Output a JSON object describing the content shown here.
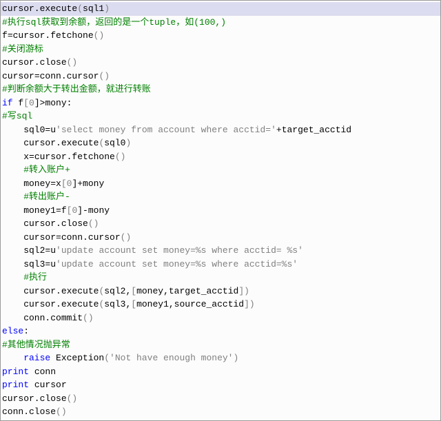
{
  "code": {
    "line01": {
      "t1": "cursor.execute",
      "t2": "(",
      "t3": "sql1",
      "t4": ")"
    },
    "line02": {
      "t1": "#执行sql获取到余额，返回的是一个tuple，如(100,)"
    },
    "line03": {
      "t1": "f",
      "t2": "=cursor.fetchone",
      "t3": "()"
    },
    "line04": {
      "t1": "#关闭游标"
    },
    "line05": {
      "t1": "cursor.close",
      "t2": "()"
    },
    "line06": {
      "t1": "cursor",
      "t2": "=conn.cursor",
      "t3": "()"
    },
    "line07": {
      "t1": "#判断余额大于转出金额，就进行转账"
    },
    "line08": {
      "t1": "if ",
      "t2": "f",
      "t3": "[",
      "t4": "0",
      "t5": "]>mony:"
    },
    "line09": {
      "t1": "#写sql"
    },
    "line10": {
      "t1": "    sql0",
      "t2": "=u",
      "t3": "'select money from account where acctid='",
      "t4": "+target_acctid"
    },
    "line11": {
      "t1": "    cursor.execute",
      "t2": "(",
      "t3": "sql0",
      "t4": ")"
    },
    "line12": {
      "t1": "    x",
      "t2": "=cursor.fetchone",
      "t3": "()"
    },
    "line13": {
      "t1": "    #转入账户+"
    },
    "line14": {
      "t1": "    money",
      "t2": "=x",
      "t3": "[",
      "t4": "0",
      "t5": "]+mony"
    },
    "line15": {
      "t1": "    #转出账户-"
    },
    "line16": {
      "t1": "    money1",
      "t2": "=f",
      "t3": "[",
      "t4": "0",
      "t5": "]-mony"
    },
    "line17": {
      "t1": "    cursor.close",
      "t2": "()"
    },
    "line18": {
      "t1": "    cursor",
      "t2": "=conn.cursor",
      "t3": "()"
    },
    "line19": {
      "t1": "    sql2",
      "t2": "=u",
      "t3": "'update account set money=%s where acctid= %s'"
    },
    "line20": {
      "t1": "    sql3",
      "t2": "=u",
      "t3": "'update account set money=%s where acctid=%s'"
    },
    "line21": {
      "t1": "    #执行"
    },
    "line22": {
      "t1": "    cursor.execute",
      "t2": "(",
      "t3": "sql2,",
      "t4": "[",
      "t5": "money,target_acctid",
      "t6": "])"
    },
    "line23": {
      "t1": "    cursor.execute",
      "t2": "(",
      "t3": "sql3,",
      "t4": "[",
      "t5": "money1,source_acctid",
      "t6": "])"
    },
    "line24": {
      "t1": "    conn.commit",
      "t2": "()"
    },
    "line25": {
      "t1": "else",
      "t2": ":"
    },
    "line26": {
      "t1": "#其他情况抛异常"
    },
    "line27": {
      "t1": "    raise ",
      "t2": "Exception",
      "t3": "(",
      "t4": "'Not have enough money'",
      "t5": ")"
    },
    "line28": {
      "t1": "print ",
      "t2": "conn"
    },
    "line29": {
      "t1": "print ",
      "t2": "cursor"
    },
    "line30": {
      "t1": "cursor.close",
      "t2": "()"
    },
    "line31": {
      "t1": "conn.close",
      "t2": "()"
    }
  }
}
